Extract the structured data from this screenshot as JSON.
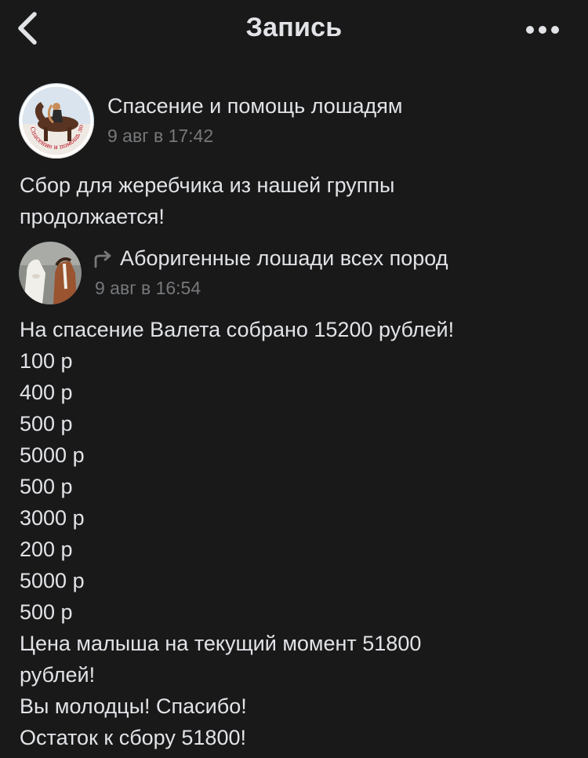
{
  "nav": {
    "title": "Запись"
  },
  "post": {
    "author": "Спасение и помощь лошадям",
    "date": "9 авг в 17:42",
    "text": "Сбор для жеребчика из нашей группы\nпродолжается!",
    "avatar_seal_text": "Спасение и помощь лошадям"
  },
  "repost": {
    "author": "Аборигенные лошади всех пород",
    "date": "9 авг в 16:54",
    "text": "На спасение Валета собрано 15200 рублей!\n100 р\n400 р\n500 р\n5000 р\n500 р\n3000 р\n200 р\n5000 р\n500 р\nЦена малыша на текущий момент 51800\nрублей!\nВы молодцы! Спасибо!\nОстаток к сбору  51800!"
  },
  "icons": {
    "back": "chevron-left-icon",
    "more": "more-horizontal-icon",
    "repost": "repost-arrow-icon"
  },
  "colors": {
    "background": "#19191a",
    "text_primary": "#e1e3e6",
    "text_secondary": "#76787a"
  }
}
